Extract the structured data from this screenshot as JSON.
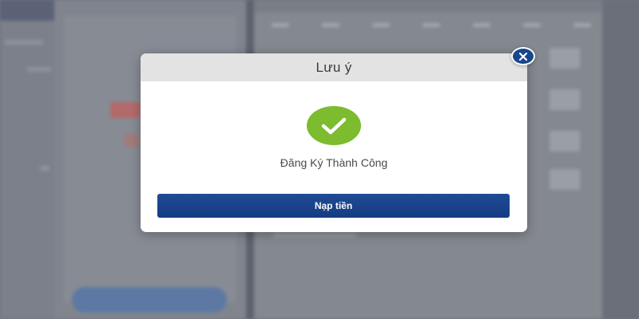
{
  "modal": {
    "title": "Lưu ý",
    "message": "Đăng Ký Thành Công",
    "primary_button_label": "Nạp tiền",
    "status_icon": "checkmark-icon",
    "close_icon": "close-icon"
  },
  "colors": {
    "success": "#7dbb2f",
    "primary": "#1f4b95",
    "close": "#17468c",
    "header": "#e3e3e3"
  }
}
